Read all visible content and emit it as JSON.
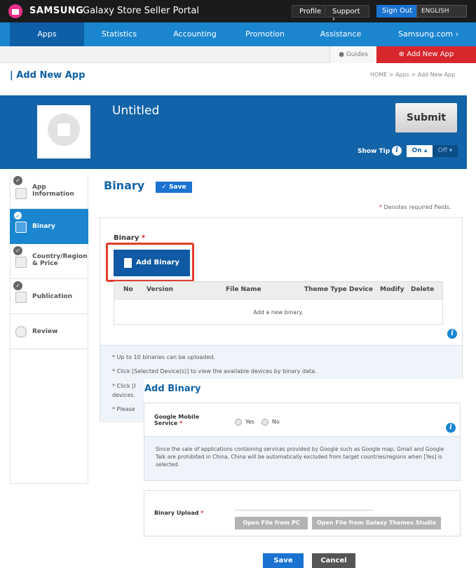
{
  "topbar": {
    "brand": "SAMSUNG",
    "brand_sub": "Galaxy Store Seller Portal",
    "profile": "Profile",
    "support": "Support ›",
    "sign_out": "Sign Out",
    "language": "ENGLISH"
  },
  "nav": {
    "items": [
      "Apps",
      "Statistics",
      "Accounting",
      "Promotion",
      "Assistance",
      "Samsung.com ›"
    ]
  },
  "subbar": {
    "guides": "Guides",
    "add_new_app": "Add New App"
  },
  "page": {
    "title": "Add New App",
    "breadcrumb": "HOME > Apps > Add New App"
  },
  "header": {
    "app_name": "Untitled",
    "submit": "Submit",
    "show_tip": "Show Tip",
    "tip_on": "On ▴",
    "tip_off": "Off ▾"
  },
  "sidebar": {
    "items": [
      {
        "label": "App Information"
      },
      {
        "label": "Binary"
      },
      {
        "label": "Country/Region & Price"
      },
      {
        "label": "Publication"
      },
      {
        "label": "Review"
      }
    ]
  },
  "main": {
    "section_title": "Binary",
    "save": "✓ Save",
    "required_note_star": "*",
    "required_note": "Denotes required fields.",
    "binary_label": "Binary",
    "required_star": "*",
    "add_binary": "Add Binary",
    "table": {
      "columns": [
        "No",
        "Version",
        "File Name",
        "Theme Type",
        "Device",
        "Modify",
        "Delete"
      ],
      "empty": "Add a new binary."
    },
    "tips": [
      "* Up to 10 binaries can be uploaded.",
      "* Click [Selected Device(s)] to view the available devices by binary data.",
      "* Click [I",
      "devices.",
      "* Please"
    ]
  },
  "modal": {
    "title": "Add Binary",
    "gms_label": "Google Mobile Service",
    "gms_star": "*",
    "yes": "Yes",
    "no": "No",
    "note": "Since the sale of applications containing services provided by Google such as Google map, Gmail and Google Talk are prohibited in China, China will be automatically excluded from target countries/regions when [Yes] is selected.",
    "upload_label": "Binary Upload",
    "upload_star": "*",
    "open_pc": "Open File from PC",
    "open_themes": "Open File from Galaxy Themes Studio",
    "save": "Save",
    "cancel": "Cancel"
  },
  "colors": {
    "nav_blue": "#1a86d0",
    "header_blue": "#1263a7",
    "accent_red": "#d8262d",
    "highlight_frame": "#e23b2e"
  }
}
